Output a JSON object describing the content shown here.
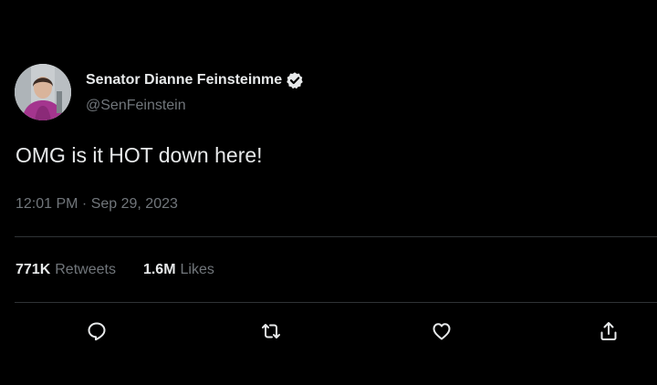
{
  "tweet": {
    "author": {
      "name": "Senator Dianne Feinsteinme",
      "handle": "@SenFeinstein",
      "verified": true
    },
    "text": "OMG is it HOT down here!",
    "timestamp": "12:01 PM · Sep 29, 2023",
    "stats": {
      "retweets": {
        "count": "771K",
        "label": "Retweets"
      },
      "likes": {
        "count": "1.6M",
        "label": "Likes"
      }
    },
    "actions": [
      "reply-icon",
      "retweet-icon",
      "like-icon",
      "share-icon"
    ]
  },
  "colors": {
    "background": "#000000",
    "primary_text": "#e7e9ea",
    "secondary_text": "#71767b",
    "divider": "#2f3336"
  }
}
